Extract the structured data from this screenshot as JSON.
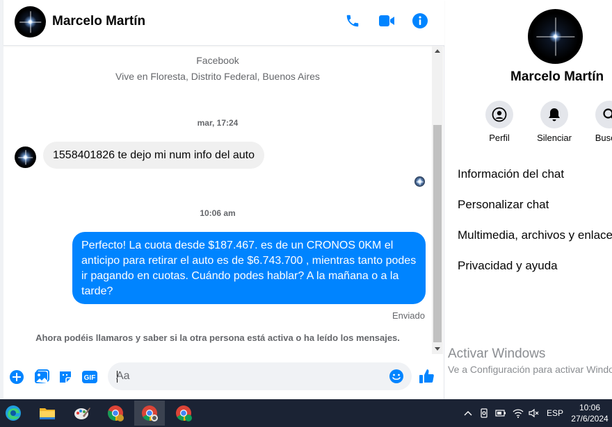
{
  "contact": {
    "name": "Marcelo Martín"
  },
  "chat": {
    "intro_source": "Facebook",
    "intro_location": "Vive en Floresta, Distrito Federal, Buenos Aires",
    "timestamp_1": "mar, 17:24",
    "incoming_message": "1558401826 te dejo mi num info del auto",
    "timestamp_2": "10:06 am",
    "outgoing_message": "Perfecto! La cuota desde $187.467. es de un CRONOS 0KM el anticipo para retirar el auto es de $6.743.700 , mientras tanto podes ir pagando en cuotas. Cuándo podes hablar? A la mañana o a la tarde?",
    "delivery_status": "Enviado",
    "call_notice": "Ahora podéis llamaros y saber si la otra persona está activa o ha leído los mensajes."
  },
  "composer": {
    "placeholder": "Aa"
  },
  "info_panel": {
    "actions": [
      {
        "label": "Perfil",
        "icon": "profile-icon"
      },
      {
        "label": "Silenciar",
        "icon": "bell-icon"
      },
      {
        "label": "Buscar",
        "icon": "search-icon"
      }
    ],
    "menu": [
      "Información del chat",
      "Personalizar chat",
      "Multimedia, archivos y enlaces",
      "Privacidad y ayuda"
    ]
  },
  "watermark": {
    "title": "Activar Windows",
    "subtitle": "Ve a Configuración para activar Windows."
  },
  "taskbar": {
    "apps": [
      "edge-icon",
      "file-explorer-icon",
      "paint-icon",
      "chrome-icon",
      "chrome-profile-icon",
      "chrome-profile-t-icon"
    ],
    "language": "ESP",
    "time": "10:06",
    "date": "27/6/2024"
  },
  "colors": {
    "messenger_blue": "#0084ff",
    "taskbar": "#1b2334",
    "bubble_gray": "#f0f0f0"
  }
}
